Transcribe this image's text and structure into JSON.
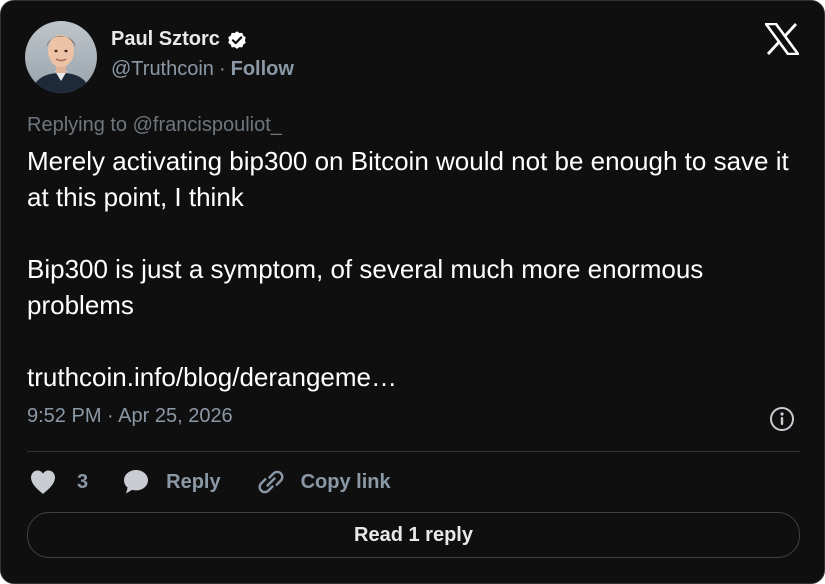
{
  "author": {
    "display_name": "Paul Sztorc",
    "handle": "@Truthcoin",
    "separator": "·",
    "follow_label": "Follow",
    "verified_icon": "verified-badge-icon",
    "avatar": "profile-photo"
  },
  "header": {
    "logo_icon": "x-logo-icon"
  },
  "tweet": {
    "replying_to": "Replying to @francispouliot_",
    "paragraphs": [
      "Merely activating bip300 on Bitcoin would not be enough to save it at this point, I think",
      "Bip300 is just a symptom, of several much more enormous problems"
    ],
    "link_text": "truthcoin.info/blog/derangeme…",
    "timestamp": "9:52 PM · Apr 25, 2026",
    "info_icon": "info-icon"
  },
  "actions": {
    "like_icon": "heart-icon",
    "like_count": "3",
    "reply_icon": "speech-bubble-icon",
    "reply_label": "Reply",
    "copy_icon": "link-icon",
    "copy_label": "Copy link"
  },
  "footer": {
    "read_replies_label": "Read 1 reply"
  },
  "colors": {
    "background": "#0f0f10",
    "text_primary": "#e7e9ea",
    "text_secondary": "#8b98a5",
    "border": "#2f3336"
  }
}
